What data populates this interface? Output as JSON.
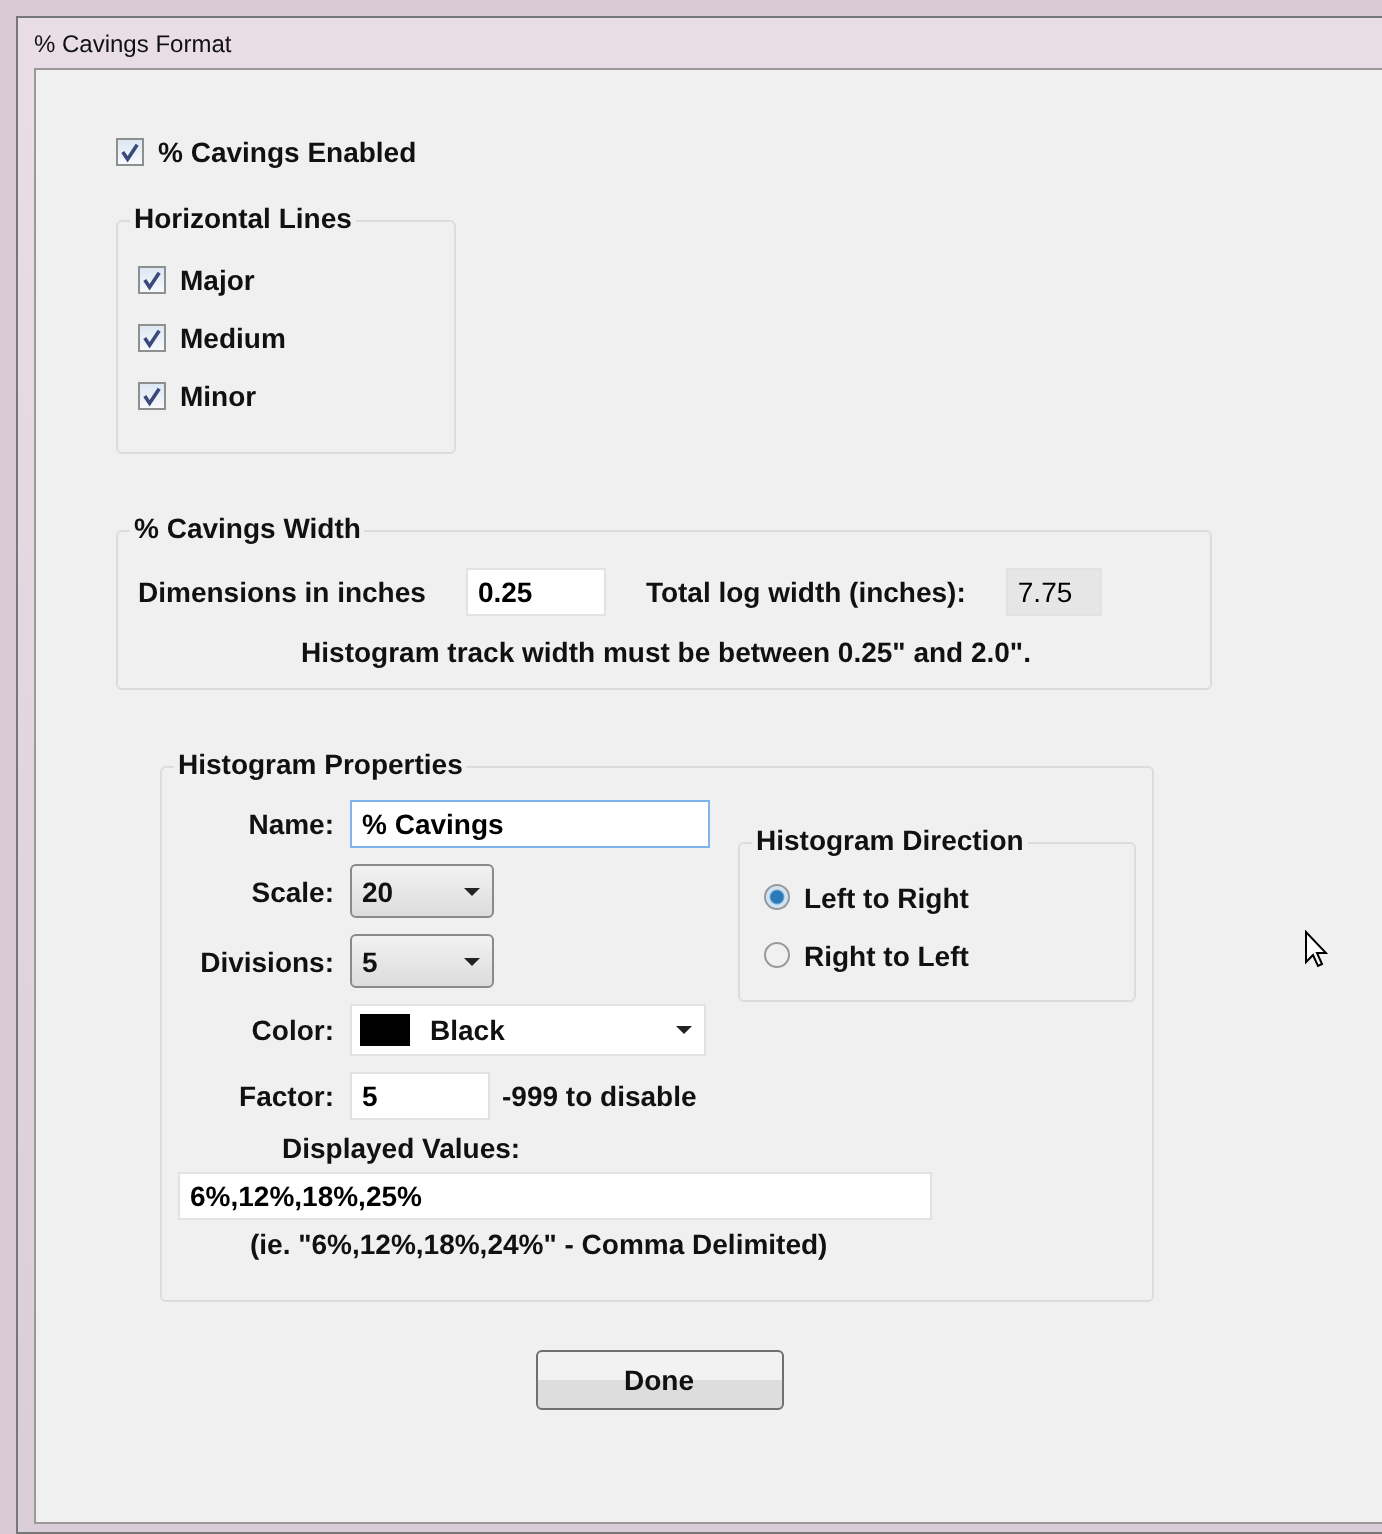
{
  "window": {
    "title": "% Cavings Format"
  },
  "enabled": {
    "label": "% Cavings Enabled",
    "checked": true
  },
  "horizontal_lines": {
    "title": "Horizontal Lines",
    "items": [
      {
        "label": "Major",
        "checked": true
      },
      {
        "label": "Medium",
        "checked": true
      },
      {
        "label": "Minor",
        "checked": true
      }
    ]
  },
  "width": {
    "title": "% Cavings Width",
    "dimensions_label": "Dimensions in inches",
    "dimensions_value": "0.25",
    "total_label": "Total log width (inches):",
    "total_value": "7.75",
    "note": "Histogram track width must be between 0.25\" and 2.0\"."
  },
  "histogram": {
    "title": "Histogram Properties",
    "name_label": "Name:",
    "name_value": "% Cavings",
    "scale_label": "Scale:",
    "scale_value": "20",
    "divisions_label": "Divisions:",
    "divisions_value": "5",
    "color_label": "Color:",
    "color_value": "Black",
    "color": "#000000",
    "factor_label": "Factor:",
    "factor_value": "5",
    "factor_hint": "-999 to disable",
    "values_label": "Displayed Values:",
    "values_value": "6%,12%,18%,25%",
    "values_hint": "(ie. \"6%,12%,18%,24%\" - Comma Delimited)",
    "direction": {
      "title": "Histogram Direction",
      "options": [
        {
          "label": "Left to Right",
          "selected": true
        },
        {
          "label": "Right to Left",
          "selected": false
        }
      ]
    }
  },
  "buttons": [
    "Done"
  ]
}
